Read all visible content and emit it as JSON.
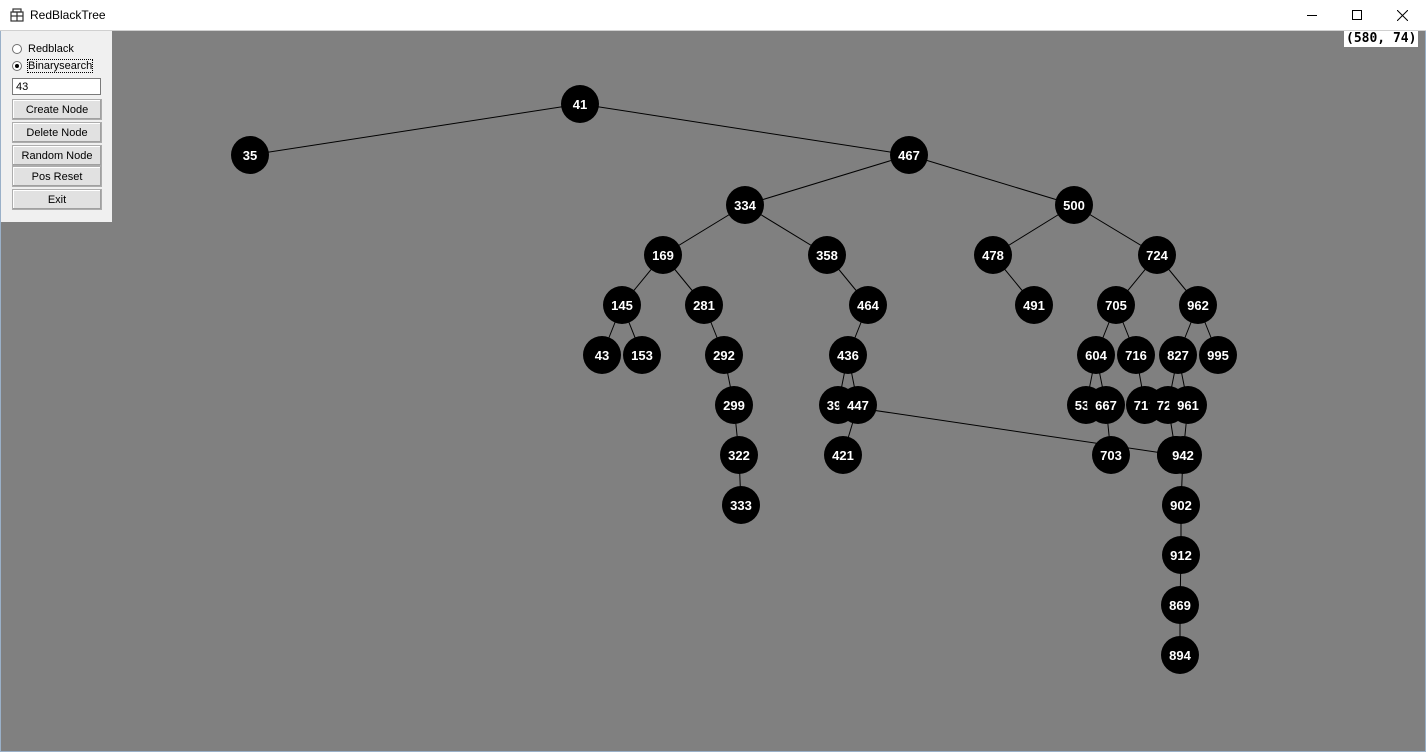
{
  "window": {
    "title": "RedBlackTree",
    "controls": [
      "minimize-icon",
      "maximize-icon",
      "close-icon"
    ]
  },
  "panel": {
    "radio_redblack": {
      "label": "Redblack",
      "checked": false
    },
    "radio_binarysearch": {
      "label": "Binarysearch",
      "checked": true
    },
    "input_value": "43",
    "buttons": {
      "create": "Create Node",
      "delete": "Delete Node",
      "random": "Random Node",
      "pos_reset": "Pos Reset",
      "exit": "Exit"
    }
  },
  "cursor_readout": "(580, 74)",
  "colors": {
    "canvas_bg": "#808080",
    "node_fill": "#000000",
    "node_text": "#ffffff",
    "edge": "#000000"
  },
  "tree": {
    "mode": "Binarysearch",
    "nodes": [
      "41",
      "35",
      "467",
      "334",
      "500",
      "169",
      "358",
      "478",
      "724",
      "145",
      "281",
      "464",
      "491",
      "705",
      "962",
      "43",
      "153",
      "292",
      "436",
      "604",
      "716",
      "827",
      "995",
      "299",
      "39?",
      "447",
      "53?",
      "667",
      "71?",
      "72?",
      "961",
      "322",
      "?",
      "421",
      "703",
      "?",
      "942",
      "333",
      "902",
      "912",
      "869",
      "894"
    ],
    "edges": [
      [
        "41",
        "35"
      ],
      [
        "41",
        "467"
      ],
      [
        "467",
        "334"
      ],
      [
        "467",
        "500"
      ],
      [
        "334",
        "169"
      ],
      [
        "334",
        "358"
      ],
      [
        "169",
        "145"
      ],
      [
        "169",
        "281"
      ],
      [
        "145",
        "43"
      ],
      [
        "145",
        "153"
      ],
      [
        "281",
        "292"
      ],
      [
        "292",
        "299"
      ],
      [
        "299",
        "322"
      ],
      [
        "322",
        "333"
      ],
      [
        "358",
        "464"
      ],
      [
        "464",
        "436"
      ],
      [
        "436",
        "39?"
      ],
      [
        "436",
        "447"
      ],
      [
        "39?",
        "?"
      ],
      [
        "447",
        "421"
      ],
      [
        "500",
        "478"
      ],
      [
        "500",
        "724"
      ],
      [
        "478",
        "491"
      ],
      [
        "724",
        "705"
      ],
      [
        "724",
        "962"
      ],
      [
        "705",
        "604"
      ],
      [
        "705",
        "716"
      ],
      [
        "604",
        "53?"
      ],
      [
        "604",
        "667"
      ],
      [
        "667",
        "703"
      ],
      [
        "716",
        "71?"
      ],
      [
        "962",
        "827"
      ],
      [
        "962",
        "995"
      ],
      [
        "827",
        "72?"
      ],
      [
        "827",
        "961"
      ],
      [
        "72?",
        "?"
      ],
      [
        "961",
        "942"
      ],
      [
        "942",
        "902"
      ],
      [
        "902",
        "912"
      ],
      [
        "912",
        "869"
      ],
      [
        "869",
        "894"
      ]
    ]
  }
}
